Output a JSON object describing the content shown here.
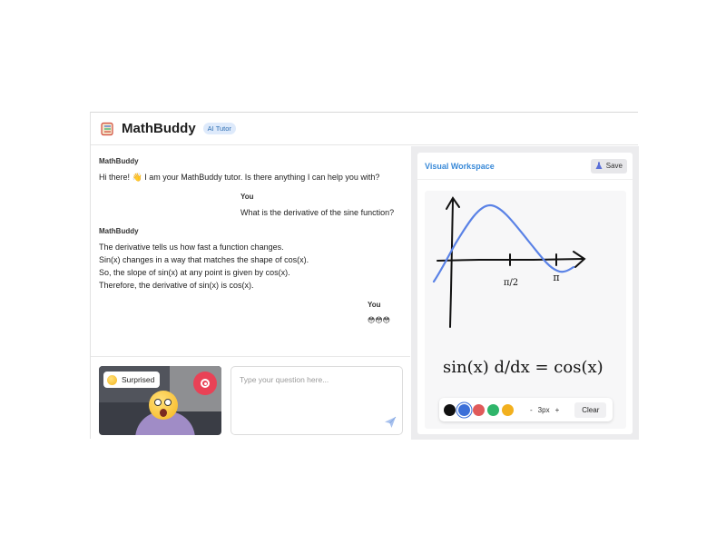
{
  "header": {
    "title": "MathBuddy",
    "badge": "AI Tutor",
    "logo_icon": "notebook-icon"
  },
  "chat": {
    "messages": [
      {
        "sender": "MathBuddy",
        "lines": [
          "Hi there! 👋 I am your MathBuddy tutor. Is there anything I can help you with?"
        ]
      },
      {
        "sender": "You",
        "lines": [
          "What is the derivative of the sine function?"
        ]
      },
      {
        "sender": "MathBuddy",
        "lines": [
          "The derivative tells us how fast a function changes.",
          "Sin(x) changes in a way that matches the shape of cos(x).",
          "So, the slope of sin(x) at any point is given by cos(x).",
          "Therefore, the derivative of sin(x) is cos(x)."
        ]
      },
      {
        "sender": "You",
        "lines": [
          "😳😳😳"
        ]
      }
    ]
  },
  "camera": {
    "emotion_label": "Surprised",
    "emotion_icon": "surprised-face-icon",
    "record_icon": "record-icon"
  },
  "input": {
    "placeholder": "Type your question here...",
    "value": "",
    "send_icon": "send-icon"
  },
  "workspace": {
    "title": "Visual Workspace",
    "save_label": "Save",
    "save_icon": "flask-icon",
    "handwriting": "sin(x) d/dx = cos(x)",
    "axis_marks": [
      "π/2",
      "π"
    ],
    "colors": [
      "#111111",
      "#3b6fd8",
      "#e05a5a",
      "#2fb56a",
      "#f2b01e"
    ],
    "selected_color": "#3b6fd8",
    "pen_size": "3px",
    "decrease_label": "-",
    "increase_label": "+",
    "clear_label": "Clear"
  }
}
